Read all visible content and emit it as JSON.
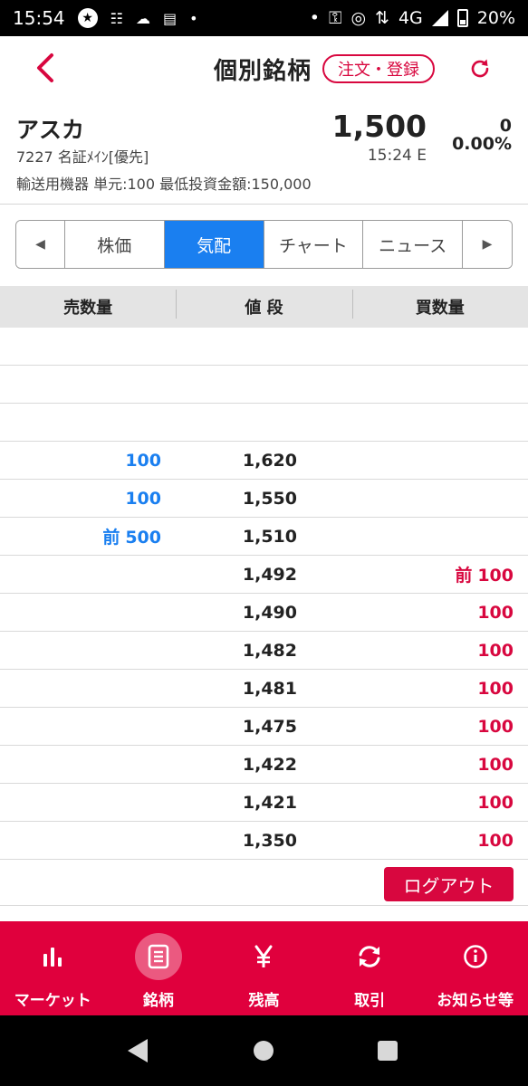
{
  "status_bar": {
    "time": "15:54",
    "network": "4G",
    "battery": "20%"
  },
  "header": {
    "title": "個別銘柄",
    "order_button": "注文・登録"
  },
  "stock": {
    "name": "アスカ",
    "code_market": "7227 名証ﾒｲﾝ[優先]",
    "sector_info": "輸送用機器 単元:100 最低投資金額:150,000",
    "price": "1,500",
    "time": "15:24 E",
    "change": "0",
    "change_pct": "0.00%"
  },
  "tabs": {
    "prev_arrow": "◀",
    "next_arrow": "▶",
    "items": [
      "株価",
      "気配",
      "チャート",
      "ニュース"
    ],
    "active": "気配"
  },
  "board": {
    "headers": [
      "売数量",
      "値 段",
      "買数量"
    ],
    "rows": [
      {
        "sell_prefix": "",
        "sell": "",
        "price": "",
        "buy_prefix": "",
        "buy": ""
      },
      {
        "sell_prefix": "",
        "sell": "",
        "price": "",
        "buy_prefix": "",
        "buy": ""
      },
      {
        "sell_prefix": "",
        "sell": "",
        "price": "",
        "buy_prefix": "",
        "buy": ""
      },
      {
        "sell_prefix": "",
        "sell": "100",
        "price": "1,620",
        "buy_prefix": "",
        "buy": ""
      },
      {
        "sell_prefix": "",
        "sell": "100",
        "price": "1,550",
        "buy_prefix": "",
        "buy": ""
      },
      {
        "sell_prefix": "前",
        "sell": "500",
        "price": "1,510",
        "buy_prefix": "",
        "buy": ""
      },
      {
        "sell_prefix": "",
        "sell": "",
        "price": "1,492",
        "buy_prefix": "前",
        "buy": "100"
      },
      {
        "sell_prefix": "",
        "sell": "",
        "price": "1,490",
        "buy_prefix": "",
        "buy": "100"
      },
      {
        "sell_prefix": "",
        "sell": "",
        "price": "1,482",
        "buy_prefix": "",
        "buy": "100"
      },
      {
        "sell_prefix": "",
        "sell": "",
        "price": "1,481",
        "buy_prefix": "",
        "buy": "100"
      },
      {
        "sell_prefix": "",
        "sell": "",
        "price": "1,475",
        "buy_prefix": "",
        "buy": "100"
      },
      {
        "sell_prefix": "",
        "sell": "",
        "price": "1,422",
        "buy_prefix": "",
        "buy": "100"
      },
      {
        "sell_prefix": "",
        "sell": "",
        "price": "1,421",
        "buy_prefix": "",
        "buy": "100"
      },
      {
        "sell_prefix": "",
        "sell": "",
        "price": "1,350",
        "buy_prefix": "",
        "buy": "100"
      }
    ]
  },
  "logout_button": "ログアウト",
  "bottom_nav": {
    "items": [
      {
        "label": "マーケット",
        "icon": "bar-chart-icon"
      },
      {
        "label": "銘柄",
        "icon": "document-icon"
      },
      {
        "label": "残高",
        "icon": "yen-icon"
      },
      {
        "label": "取引",
        "icon": "sync-icon"
      },
      {
        "label": "お知らせ等",
        "icon": "info-icon"
      }
    ],
    "active": "銘柄"
  },
  "colors": {
    "brand_red": "#d8073f",
    "nav_red": "#e0003d",
    "tab_blue": "#1a7ff0",
    "sell_blue": "#1a7ff0",
    "buy_red": "#d8073f"
  }
}
